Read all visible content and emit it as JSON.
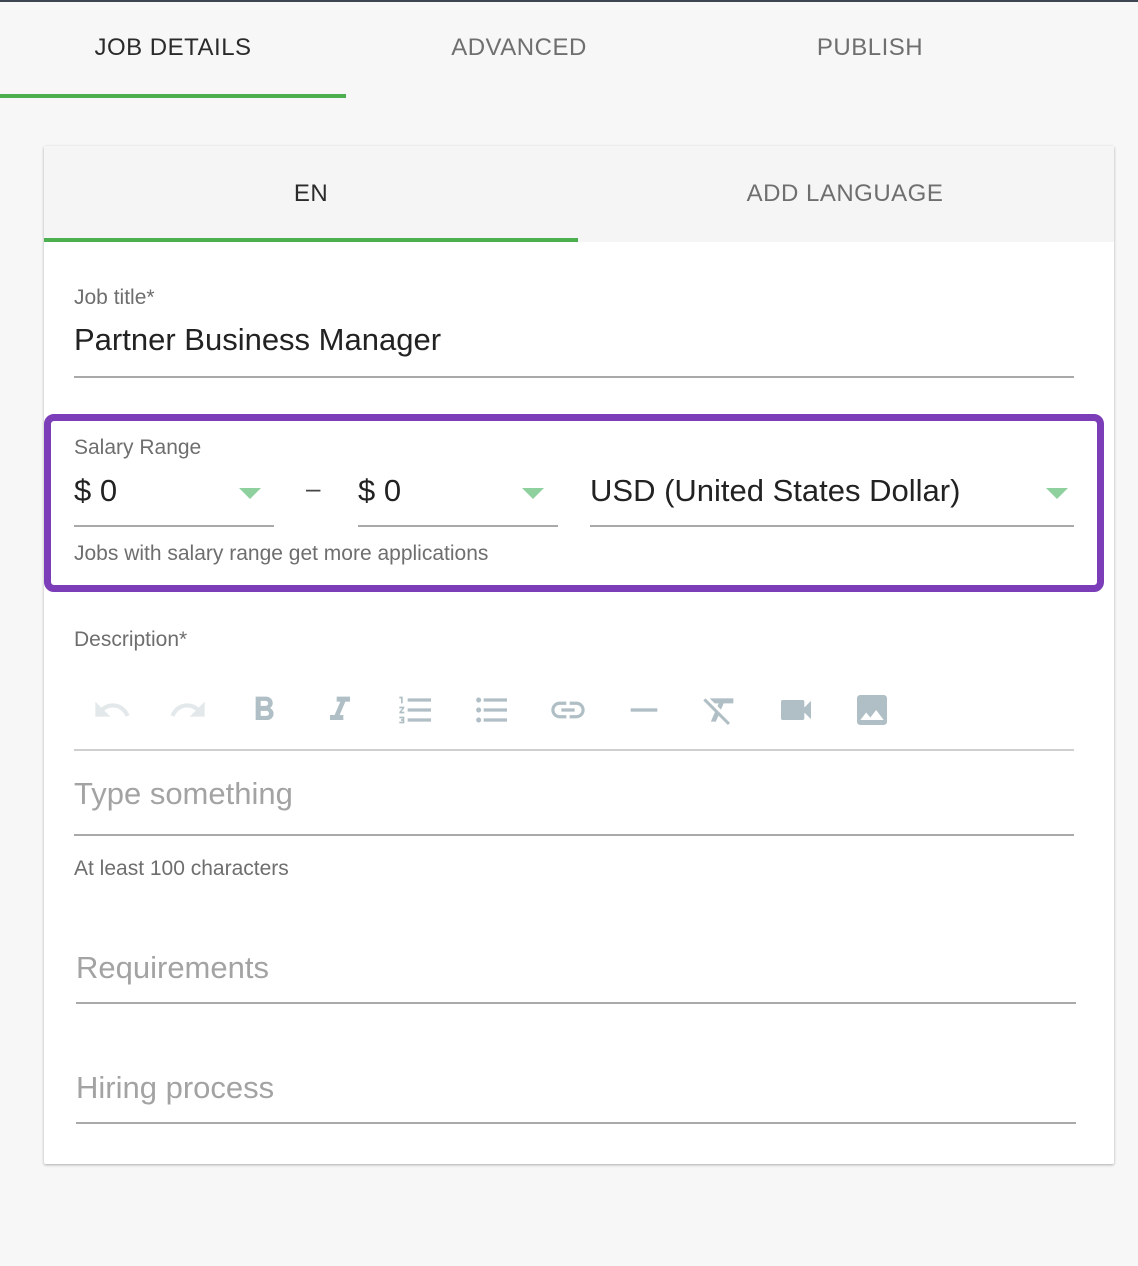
{
  "step_tabs": [
    {
      "label": "JOB DETAILS",
      "active": true
    },
    {
      "label": "ADVANCED",
      "active": false
    },
    {
      "label": "PUBLISH",
      "active": false
    }
  ],
  "lang_tabs": [
    {
      "label": "EN",
      "active": true
    },
    {
      "label": "ADD LANGUAGE",
      "active": false
    }
  ],
  "job_title": {
    "label": "Job title*",
    "value": "Partner Business Manager"
  },
  "salary": {
    "label": "Salary Range",
    "min_value": "$ 0",
    "separator": "–",
    "max_value": "$ 0",
    "currency": "USD (United States Dollar)",
    "helper": "Jobs with salary range get more applications"
  },
  "description": {
    "label": "Description*",
    "placeholder": "Type something",
    "helper": "At least 100 characters",
    "toolbar": [
      "undo-icon",
      "redo-icon",
      "bold-icon",
      "italic-icon",
      "ordered-list-icon",
      "bullet-list-icon",
      "link-icon",
      "horizontal-rule-icon",
      "clear-format-icon",
      "video-icon",
      "image-icon"
    ]
  },
  "requirements": {
    "placeholder": "Requirements"
  },
  "hiring_process": {
    "placeholder": "Hiring process"
  },
  "colors": {
    "accent": "#4caf50",
    "highlight": "#7c3db8",
    "caret": "#8fd19e",
    "icon": "#b0bec5"
  }
}
